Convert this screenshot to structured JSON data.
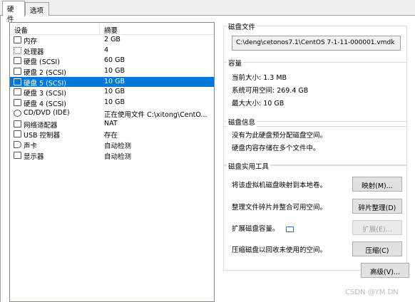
{
  "tabs": {
    "hardware": "硬件",
    "options": "选项"
  },
  "device_list": {
    "header_device": "设备",
    "header_summary": "摘要",
    "items": [
      {
        "name": "内存",
        "summary": "2 GB",
        "icon": "memory-icon"
      },
      {
        "name": "处理器",
        "summary": "4",
        "icon": "cpu-icon"
      },
      {
        "name": "硬盘 (SCSI)",
        "summary": "60 GB",
        "icon": "disk-icon"
      },
      {
        "name": "硬盘 2 (SCSI)",
        "summary": "10 GB",
        "icon": "disk-icon"
      },
      {
        "name": "硬盘 5 (SCSI)",
        "summary": "10 GB",
        "icon": "disk-icon"
      },
      {
        "name": "硬盘 3 (SCSI)",
        "summary": "10 GB",
        "icon": "disk-icon"
      },
      {
        "name": "硬盘 4 (SCSI)",
        "summary": "10 GB",
        "icon": "disk-icon"
      },
      {
        "name": "CD/DVD (IDE)",
        "summary": "正在使用文件 C:\\xitong\\CentO...",
        "icon": "cd-icon"
      },
      {
        "name": "网络适配器",
        "summary": "NAT",
        "icon": "network-icon"
      },
      {
        "name": "USB 控制器",
        "summary": "存在",
        "icon": "usb-icon"
      },
      {
        "name": "声卡",
        "summary": "自动检测",
        "icon": "speaker-icon"
      },
      {
        "name": "显示器",
        "summary": "自动检测",
        "icon": "monitor-icon"
      }
    ],
    "selected_index": 4
  },
  "disk_file": {
    "title": "磁盘文件",
    "path": "C:\\deng\\cetonos7.1\\CentOS 7-1-11-000001.vmdk"
  },
  "capacity": {
    "title": "容量",
    "current_size": "当前大小: 1.3 MB",
    "system_free": "系统可用空间: 269.4 GB",
    "max_size": "最大大小: 10 GB"
  },
  "disk_info": {
    "title": "磁盘信息",
    "line1": "没有为此硬盘预分配磁盘空间。",
    "line2": "硬盘内容存储在多个文件中。"
  },
  "disk_utilities": {
    "title": "磁盘实用工具",
    "map_desc": "将该虚拟机磁盘映射到本地卷。",
    "map_button": "映射(M)...",
    "defrag_desc": "整理文件碎片并整合可用空间。",
    "defrag_button": "碎片整理(D)",
    "expand_desc": "扩展磁盘容量。",
    "expand_button": "扩展(E)...",
    "compact_desc": "压缩磁盘以回收未使用的空间。",
    "compact_button": "压缩(C)"
  },
  "advanced_button": "高级(V)...",
  "watermark": "CSDN @YM  DN"
}
